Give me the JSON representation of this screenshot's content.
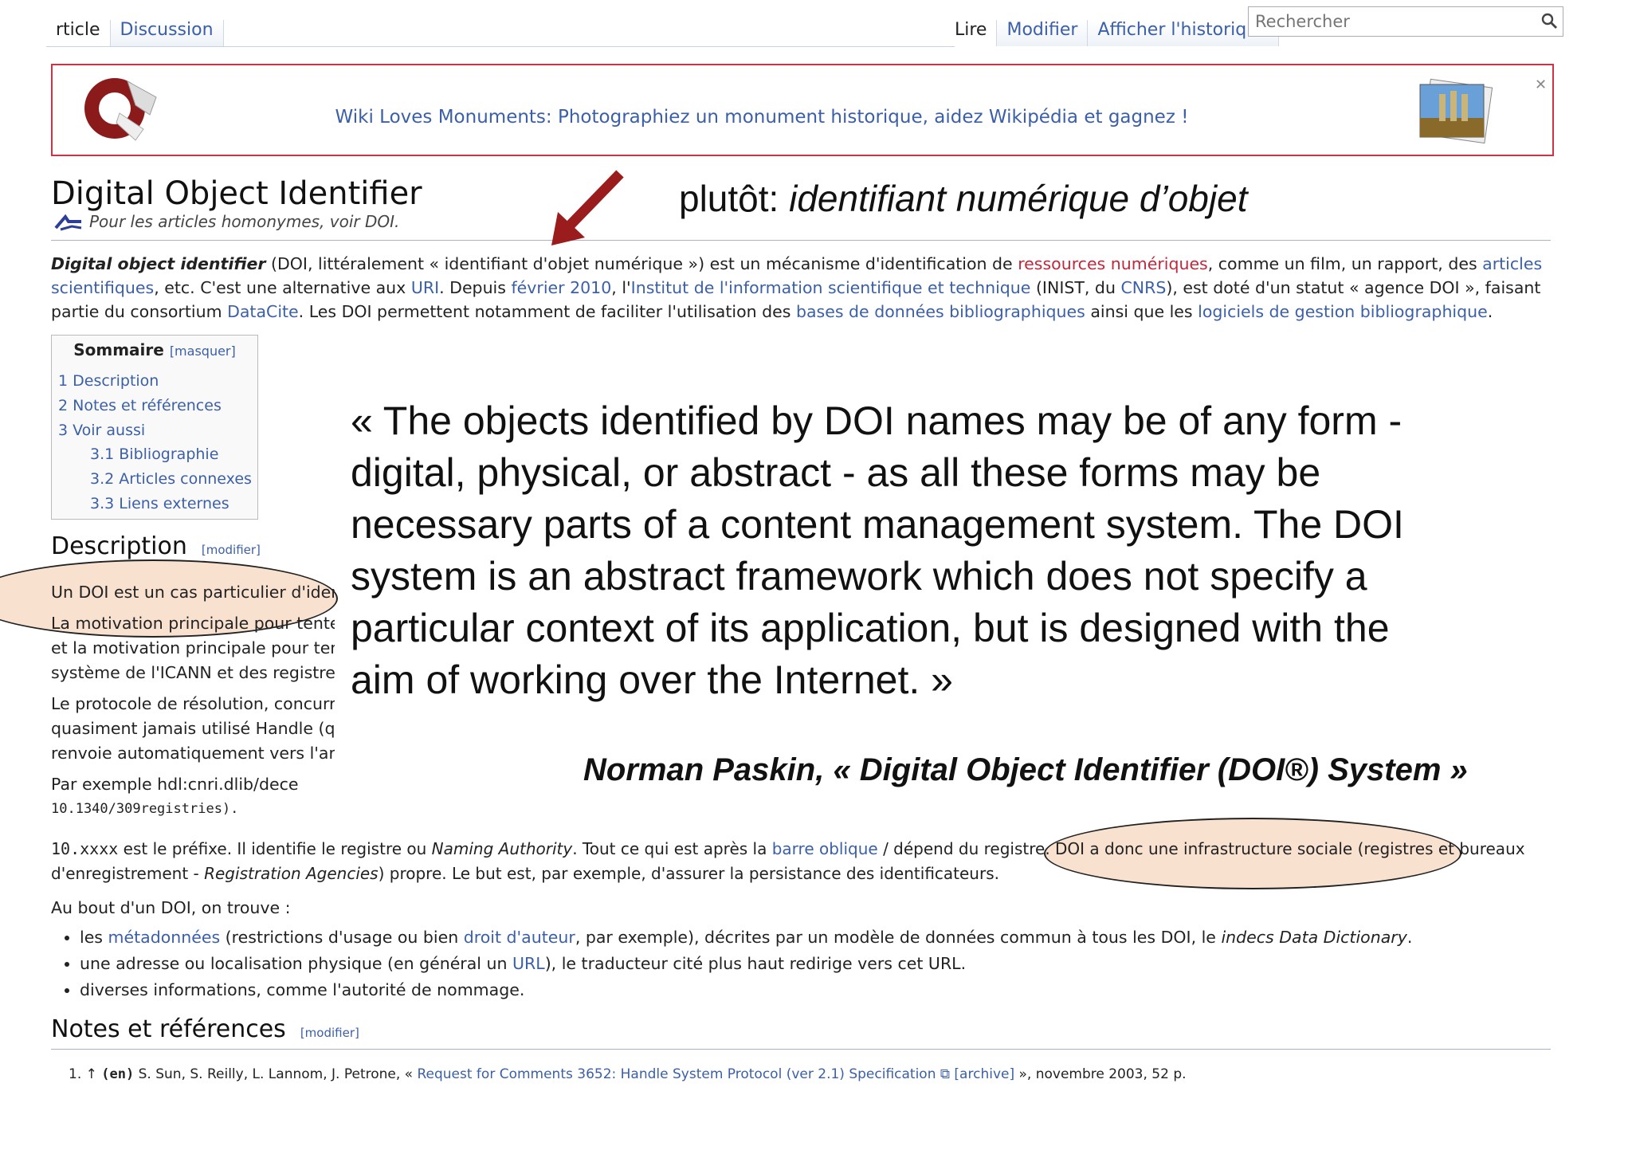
{
  "nav": {
    "tabs_left": [
      "rticle",
      "Discussion"
    ],
    "tabs_right": [
      "Lire",
      "Modifier",
      "Afficher l'historique"
    ],
    "search_placeholder": "Rechercher"
  },
  "banner": {
    "label": "Wiki Loves Monuments",
    "text": ": Photographiez un monument historique, aidez Wikipédia et gagnez !"
  },
  "article": {
    "title": "Digital Object Identifier",
    "homonym": "Pour les articles homonymes, voir DOI.",
    "lead": [
      [
        {
          "t": "Digital object identifier",
          "s": "bi"
        },
        {
          "t": " (DOI, littéralement « identifiant d'objet numérique ») est un mécanisme d'identification de "
        },
        {
          "t": "ressources numériques",
          "s": "red"
        },
        {
          "t": ", comme un film, un rapport, des "
        },
        {
          "t": "articles",
          "s": "link"
        }
      ],
      [
        {
          "t": "scientifiques",
          "s": "link"
        },
        {
          "t": ", etc. C'est une alternative aux "
        },
        {
          "t": "URI",
          "s": "link"
        },
        {
          "t": ". Depuis "
        },
        {
          "t": "février 2010",
          "s": "link"
        },
        {
          "t": ", l'"
        },
        {
          "t": "Institut de l'information scientifique et technique",
          "s": "link"
        },
        {
          "t": " (INIST, du "
        },
        {
          "t": "CNRS",
          "s": "link"
        },
        {
          "t": "), est doté d'un statut « agence DOI », faisant"
        }
      ],
      [
        {
          "t": "partie du consortium "
        },
        {
          "t": "DataCite",
          "s": "link"
        },
        {
          "t": ". Les DOI permettent notamment de faciliter l'utilisation des "
        },
        {
          "t": "bases de données bibliographiques",
          "s": "link"
        },
        {
          "t": " ainsi que les "
        },
        {
          "t": "logiciels de gestion bibliographique",
          "s": "link"
        },
        {
          "t": "."
        }
      ]
    ],
    "toc": {
      "title": "Sommaire",
      "toggle": "[masquer]",
      "items": [
        "1 Description",
        "2 Notes et références",
        "3 Voir aussi",
        "3.1 Bibliographie",
        "3.2 Articles connexes",
        "3.3 Liens externes"
      ]
    },
    "description_heading": "Description",
    "edit_label": "[modifier]",
    "desc_lines": [
      "Un DOI est un cas particulier d'iden",
      "La motivation principale pour tenter",
      "et la motivation principale pour tent",
      "système de l'ICANN et des registre",
      "Le protocole de résolution, concurre",
      "quasiment jamais utilisé Handle (qu",
      "renvoie automatiquement vers l'artic",
      "Par exemple hdl:cnri.dlib/dece",
      "10.1340/309registries)."
    ],
    "prefix_lines": [
      [
        {
          "t": "10.xxxx",
          "s": "mono"
        },
        {
          "t": " est le préfixe. Il identifie le registre ou "
        },
        {
          "t": "Naming Authority",
          "s": "i"
        },
        {
          "t": ". Tout ce qui est après la "
        },
        {
          "t": "barre oblique",
          "s": "link"
        },
        {
          "t": " / dépend du registre. DOI a donc une infrastructure sociale (registres et bureaux"
        }
      ],
      [
        {
          "t": "d'enregistrement - "
        },
        {
          "t": "Registration Agencies",
          "s": "i"
        },
        {
          "t": ") propre. Le but est, par exemple, d'assurer la persistance des identificateurs."
        }
      ]
    ],
    "au_bout": "Au bout d'un DOI, on trouve :",
    "bullets": [
      [
        {
          "t": "les "
        },
        {
          "t": "métadonnées",
          "s": "link"
        },
        {
          "t": " (restrictions d'usage ou bien "
        },
        {
          "t": "droit d'auteur",
          "s": "link"
        },
        {
          "t": ", par exemple), décrites par un modèle de données commun à tous les DOI, le "
        },
        {
          "t": "indecs Data Dictionary",
          "s": "i"
        },
        {
          "t": "."
        }
      ],
      [
        {
          "t": "une adresse ou localisation physique (en général un "
        },
        {
          "t": "URL",
          "s": "link"
        },
        {
          "t": "), le traducteur cité plus haut redirige vers cet URL."
        }
      ],
      [
        {
          "t": "diverses informations, comme l'autorité de nommage."
        }
      ]
    ],
    "notes_heading": "Notes et références",
    "reference": [
      {
        "t": "1.   ↑ "
      },
      {
        "t": "(en)",
        "s": "bmono"
      },
      {
        "t": " S. Sun, S. Reilly, L. Lannom, J. Petrone, « "
      },
      {
        "t": "Request for Comments 3652: Handle System Protocol (ver 2.1) Specification",
        "s": "link"
      },
      {
        "t": " ⧉ [archive]",
        "s": "link"
      },
      {
        "t": " », novembre 2003, 52 p."
      }
    ]
  },
  "overlay": {
    "plutot_prefix": "plutôt: ",
    "plutot_italic": "identifiant numérique d’objet",
    "quote_lines": [
      "« The objects identified by DOI names may be of any form -",
      "digital, physical, or abstract - as all these forms may be",
      "necessary parts of a content management system. The DOI",
      "system is an abstract framework which does not specify a",
      "particular context of its application, but is designed with the",
      "aim of working over the Internet. »"
    ],
    "attribution": "Norman Paskin, « Digital Object Identifier (DOI®) System »",
    "colors": {
      "arrow": "#9b1c1c",
      "highlight": "#f4c8aa"
    }
  }
}
